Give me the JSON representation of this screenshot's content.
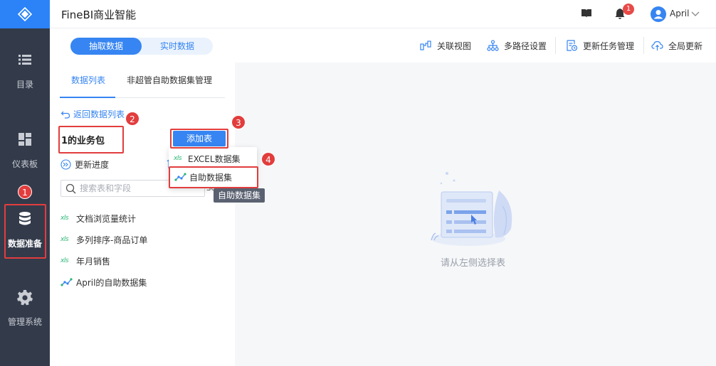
{
  "header": {
    "app_title": "FineBI商业智能",
    "notification_count": "1",
    "user_name": "April"
  },
  "nav": {
    "items": [
      {
        "label": "目录",
        "icon": "list-icon"
      },
      {
        "label": "仪表板",
        "icon": "dashboard-icon"
      },
      {
        "label": "数据准备",
        "icon": "database-icon",
        "active": true
      },
      {
        "label": "管理系统",
        "icon": "gear-icon"
      }
    ]
  },
  "toolbar": {
    "toggle": {
      "selected": "抽取数据",
      "other": "实时数据"
    },
    "actions": [
      {
        "label": "关联视图",
        "icon": "relation-icon"
      },
      {
        "label": "多路径设置",
        "icon": "multipath-icon"
      },
      {
        "label": "更新任务管理",
        "icon": "task-icon"
      },
      {
        "label": "全局更新",
        "icon": "cloud-update-icon"
      }
    ]
  },
  "panel": {
    "tabs": [
      {
        "label": "数据列表",
        "active": true
      },
      {
        "label": "非超管自助数据集管理",
        "active": false
      }
    ],
    "back_link": "返回数据列表",
    "package_name": "1的业务包",
    "add_button": "添加表",
    "progress_link": "更新进度",
    "search": {
      "placeholder": "搜索表和字段",
      "trail": "SQ"
    },
    "tables": [
      {
        "name": "文档浏览量统计",
        "type": "excel",
        "tag": "xls"
      },
      {
        "name": "多列排序-商品订单",
        "type": "excel",
        "tag": "xls"
      },
      {
        "name": "年月销售",
        "type": "excel",
        "tag": "xls"
      },
      {
        "name": "April的自助数据集",
        "type": "self-service"
      }
    ]
  },
  "dropdown": {
    "items": [
      {
        "label": "EXCEL数据集",
        "tag": "xls"
      },
      {
        "label": "自助数据集"
      }
    ],
    "tooltip": "自助数据集"
  },
  "main": {
    "empty_text": "请从左侧选择表"
  },
  "annotations": [
    "1",
    "2",
    "3",
    "4"
  ],
  "colors": {
    "accent": "#3685f2",
    "nav_bg": "#333b4b",
    "annotation_red": "#e23d3d",
    "excel_green": "#2bb673"
  }
}
